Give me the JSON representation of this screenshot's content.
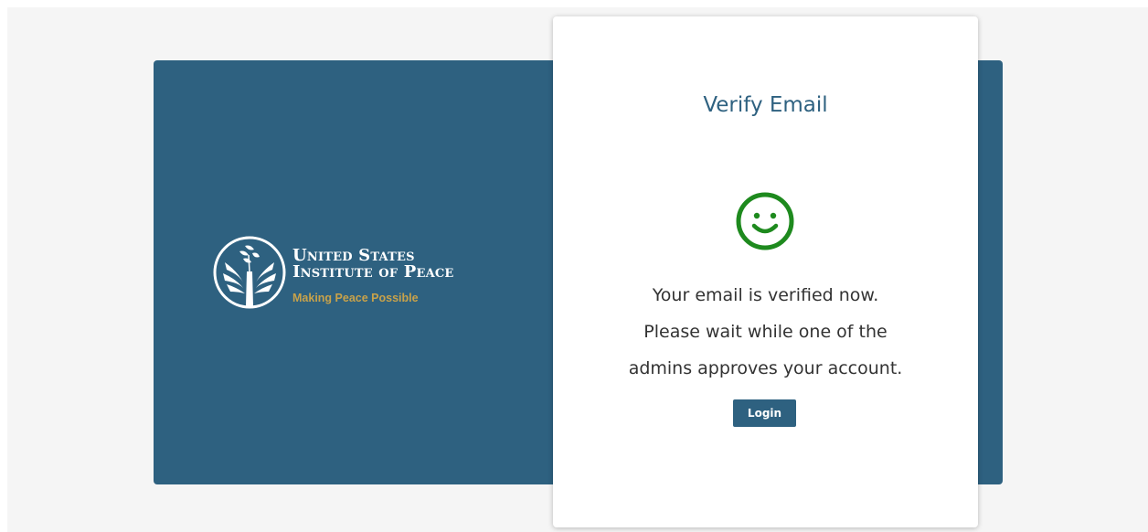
{
  "brand": {
    "name_line1": "United States",
    "name_line2": "Institute of Peace",
    "tagline": "Making Peace Possible",
    "logo_icon": "dove-olive-branch-emblem-icon",
    "panel_color": "#2e6180",
    "tagline_color": "#c8a24a"
  },
  "card": {
    "title": "Verify Email",
    "status_icon": "smiley-icon",
    "status_icon_color": "#1e8a1e",
    "message_lines": [
      "Your email is verified now.",
      "Please wait while one of the",
      "admins approves your account."
    ],
    "login_label": "Login"
  }
}
